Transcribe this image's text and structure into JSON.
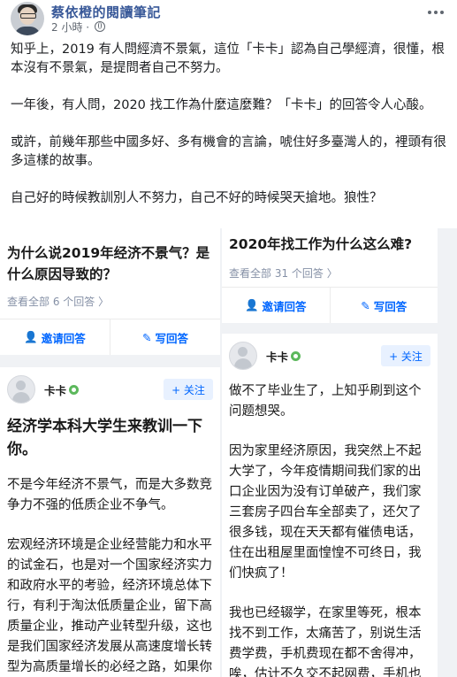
{
  "post": {
    "page_name": "蔡依橙的閱讀筆記",
    "time": "2 小時",
    "separator": "·",
    "paragraphs": [
      "知乎上，2019 有人問經濟不景氣，這位「卡卡」認為自己學經濟，很懂，根本沒有不景氣，是提問者自己不努力。",
      "一年後，有人問，2020 找工作為什麼這麼難？「卡卡」的回答令人心酸。",
      "或許，前幾年那些中國多好、多有機會的言論，唬住好多臺灣人的，裡頭有很多這樣的故事。",
      "自己好的時候教訓別人不努力，自己不好的時候哭天搶地。狼性？"
    ]
  },
  "left_card": {
    "question": "为什么说2019年经济不景气？是什么原因导致的？",
    "answer_count": "查看全部 6 个回答 〉",
    "invite_label": "邀请回答",
    "write_label": "写回答",
    "answerer": "卡卡",
    "follow_label": "+ 关注",
    "answer_title": "经济学本科大学生来教训一下你。",
    "answer_paragraphs": [
      "不是今年经济不景气，而是大多数竞争力不强的低质企业不争气。",
      "宏观经济环境是企业经营能力和水平的试金石，也是对一个国家经济实力和政府水平的考验，经济环境总体下行，有利于淘汰低质量企业，留下高质量企业，推动产业转型升级，这也是我们国家经济发展从高速度增长转型为高质量增长的必经之路，如果你连这个常识和认知都没有，你不配上"
    ]
  },
  "right_card": {
    "question": "2020年找工作为什么这么难?",
    "answer_count": "查看全部 31 个回答 〉",
    "invite_label": "邀请回答",
    "write_label": "写回答",
    "answerer": "卡卡",
    "follow_label": "+ 关注",
    "answer_paragraphs": [
      "做不了毕业生了，上知乎刷到这个问题想哭。",
      "因为家里经济原因，我突然上不起大学了，今年疫情期间我们家的出口企业因为没有订单破产，我们家三套房子四台车全部卖了，还欠了很多钱，现在天天都有催债电话，住在出租屋里面惶惶不可终日，我们快疯了！",
      "我也已经辍学，在家里等死，根本找不到工作，太痛苦了，别说生活费学费，手机费现在都不舍得冲，唉，估计不久交不起网费，手机也要卖掉，不能再在这里发帖了吧。"
    ]
  }
}
